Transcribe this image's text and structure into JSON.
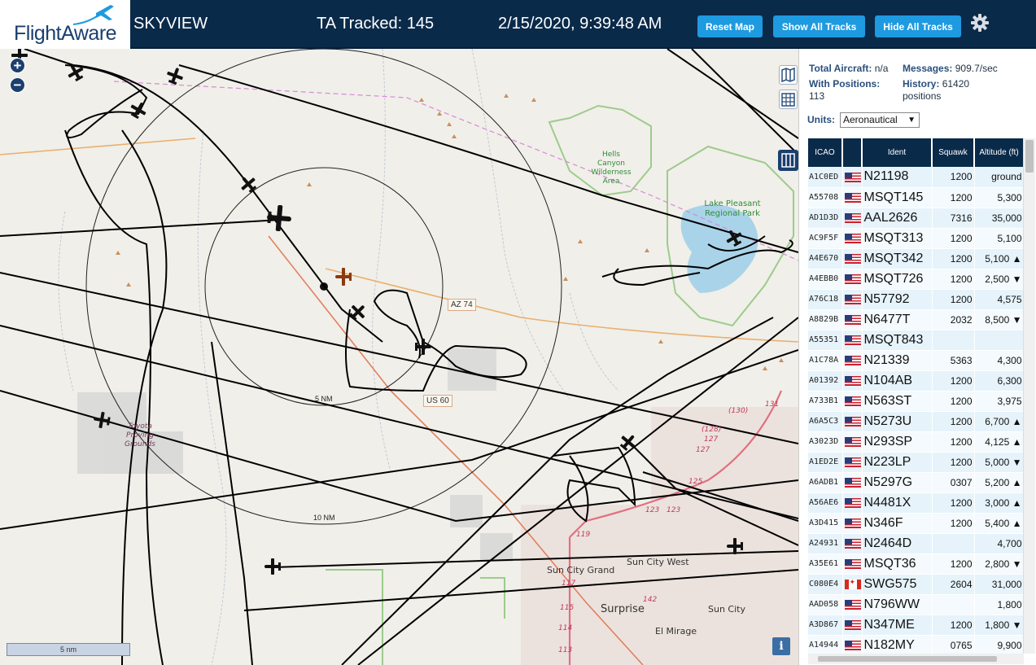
{
  "header": {
    "logo_text": "FlightAware",
    "title": "SKYVIEW",
    "tracked": "TA Tracked: 145",
    "datetime": "2/15/2020, 9:39:48 AM",
    "buttons": {
      "reset": "Reset Map",
      "show_all": "Show All Tracks",
      "hide_all": "Hide All Tracks"
    },
    "settings_icon": "gear-icon"
  },
  "map": {
    "zoom_in": "+",
    "zoom_out": "−",
    "places": {
      "hells_canyon": "Hells Canyon Wilderness Area",
      "lake_pleasant": "Lake Pleasant Regional Park",
      "toyota": "Toyota Proving Grounds",
      "sun_city_grand": "Sun City Grand",
      "sun_city_west": "Sun City West",
      "surprise": "Surprise",
      "sun_city": "Sun City",
      "el_mirage": "El Mirage"
    },
    "roads": {
      "az74": "AZ 74",
      "us60": "US 60"
    },
    "road_numbers": [
      "131",
      "(130)",
      "(128)",
      "127",
      "127",
      "125",
      "123",
      "123",
      "119",
      "117",
      "115",
      "114",
      "113",
      "142"
    ],
    "rings": {
      "inner": "5 NM",
      "outer": "10 NM"
    },
    "scale": "5 nm",
    "info": "i",
    "colors": {
      "track": "#000000",
      "background": "#f1efe9",
      "water": "#a9d3e8",
      "park_border": "#9ccc8c",
      "road_orange": "#e8b070",
      "road_red": "#e07080"
    }
  },
  "sidebar": {
    "total_aircraft_label": "Total Aircraft:",
    "total_aircraft_value": "n/a",
    "messages_label": "Messages:",
    "messages_value": "909.7/sec",
    "positions_label": "With Positions:",
    "positions_value": "113",
    "history_label": "History:",
    "history_value": "61420",
    "history_unit": "positions",
    "units_label": "Units:",
    "units_value": "Aeronautical",
    "columns": [
      "ICAO",
      "",
      "Ident",
      "Squawk",
      "Altitude (ft)"
    ],
    "rows": [
      {
        "icao": "A1C0ED",
        "flag": "US",
        "ident": "N21198",
        "squawk": "1200",
        "altitude": "ground"
      },
      {
        "icao": "A55708",
        "flag": "US",
        "ident": "MSQT145",
        "squawk": "1200",
        "altitude": "5,300"
      },
      {
        "icao": "AD1D3D",
        "flag": "US",
        "ident": "AAL2626",
        "squawk": "7316",
        "altitude": "35,000"
      },
      {
        "icao": "AC9F5F",
        "flag": "US",
        "ident": "MSQT313",
        "squawk": "1200",
        "altitude": "5,100"
      },
      {
        "icao": "A4E670",
        "flag": "US",
        "ident": "MSQT342",
        "squawk": "1200",
        "altitude": "5,100 ▲"
      },
      {
        "icao": "A4EBB0",
        "flag": "US",
        "ident": "MSQT726",
        "squawk": "1200",
        "altitude": "2,500 ▼"
      },
      {
        "icao": "A76C18",
        "flag": "US",
        "ident": "N57792",
        "squawk": "1200",
        "altitude": "4,575"
      },
      {
        "icao": "A8829B",
        "flag": "US",
        "ident": "N6477T",
        "squawk": "2032",
        "altitude": "8,500 ▼"
      },
      {
        "icao": "A55351",
        "flag": "US",
        "ident": "MSQT843",
        "squawk": "",
        "altitude": ""
      },
      {
        "icao": "A1C78A",
        "flag": "US",
        "ident": "N21339",
        "squawk": "5363",
        "altitude": "4,300"
      },
      {
        "icao": "A01392",
        "flag": "US",
        "ident": "N104AB",
        "squawk": "1200",
        "altitude": "6,300"
      },
      {
        "icao": "A733B1",
        "flag": "US",
        "ident": "N563ST",
        "squawk": "1200",
        "altitude": "3,975"
      },
      {
        "icao": "A6A5C3",
        "flag": "US",
        "ident": "N5273U",
        "squawk": "1200",
        "altitude": "6,700 ▲"
      },
      {
        "icao": "A3023D",
        "flag": "US",
        "ident": "N293SP",
        "squawk": "1200",
        "altitude": "4,125 ▲"
      },
      {
        "icao": "A1ED2E",
        "flag": "US",
        "ident": "N223LP",
        "squawk": "1200",
        "altitude": "5,000 ▼"
      },
      {
        "icao": "A6ADB1",
        "flag": "US",
        "ident": "N5297G",
        "squawk": "0307",
        "altitude": "5,200 ▲"
      },
      {
        "icao": "A56AE6",
        "flag": "US",
        "ident": "N4481X",
        "squawk": "1200",
        "altitude": "3,000 ▲"
      },
      {
        "icao": "A3D415",
        "flag": "US",
        "ident": "N346F",
        "squawk": "1200",
        "altitude": "5,400 ▲"
      },
      {
        "icao": "A24931",
        "flag": "US",
        "ident": "N2464D",
        "squawk": "",
        "altitude": "4,700"
      },
      {
        "icao": "A35E61",
        "flag": "US",
        "ident": "MSQT36",
        "squawk": "1200",
        "altitude": "2,800 ▼"
      },
      {
        "icao": "C080E4",
        "flag": "CA",
        "ident": "SWG575",
        "squawk": "2604",
        "altitude": "31,000"
      },
      {
        "icao": "AAD058",
        "flag": "US",
        "ident": "N796WW",
        "squawk": "",
        "altitude": "1,800"
      },
      {
        "icao": "A3D867",
        "flag": "US",
        "ident": "N347ME",
        "squawk": "1200",
        "altitude": "1,800 ▼"
      },
      {
        "icao": "A14944",
        "flag": "US",
        "ident": "N182MY",
        "squawk": "0765",
        "altitude": "9,900"
      }
    ]
  }
}
